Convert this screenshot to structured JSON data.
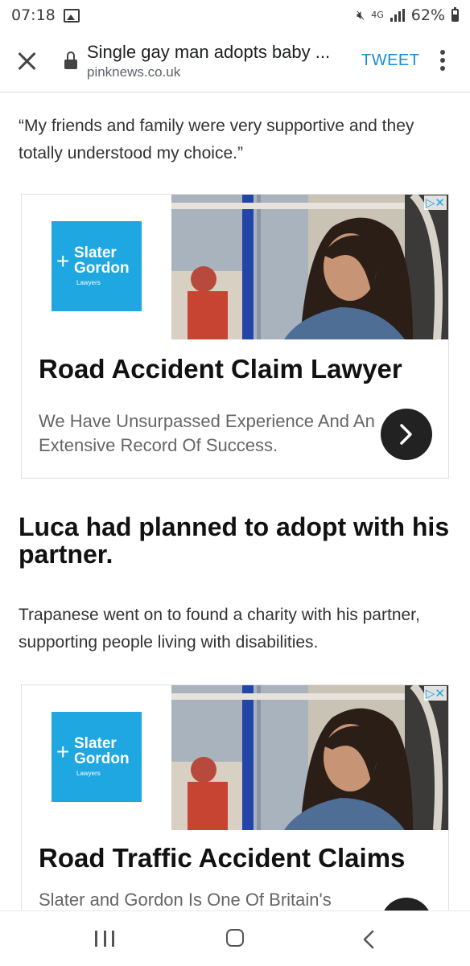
{
  "status_bar": {
    "time": "07:18",
    "network": "4G",
    "battery": "62%",
    "battery_level": 0.62,
    "icons": [
      "image-icon",
      "mute-icon",
      "signal-icon",
      "battery-icon"
    ]
  },
  "toolbar": {
    "title": "Single gay man adopts baby ...",
    "url": "pinknews.co.uk",
    "tweet_label": "TWEET"
  },
  "article": {
    "quote": "“My friends and family were very supportive and they totally understood my choice.”",
    "heading": "Luca had planned to adopt with his partner.",
    "paragraph": "Trapanese went on to found a charity with his partner, supporting people living with disabilities."
  },
  "ads": [
    {
      "logo_line1": "Slater",
      "logo_line2": "Gordon",
      "logo_line3": "Lawyers",
      "headline": "Road Accident Claim Lawyer",
      "description": "We Have Unsurpassed Experience And An Extensive Record Of Success."
    },
    {
      "logo_line1": "Slater",
      "logo_line2": "Gordon",
      "logo_line3": "Lawyers",
      "headline": "Road Traffic Accident Claims",
      "description": "Slater and Gordon Is One Of Britain's"
    }
  ],
  "colors": {
    "brand_blue": "#1ea7e1",
    "tweet_blue": "#1a8cd8"
  }
}
